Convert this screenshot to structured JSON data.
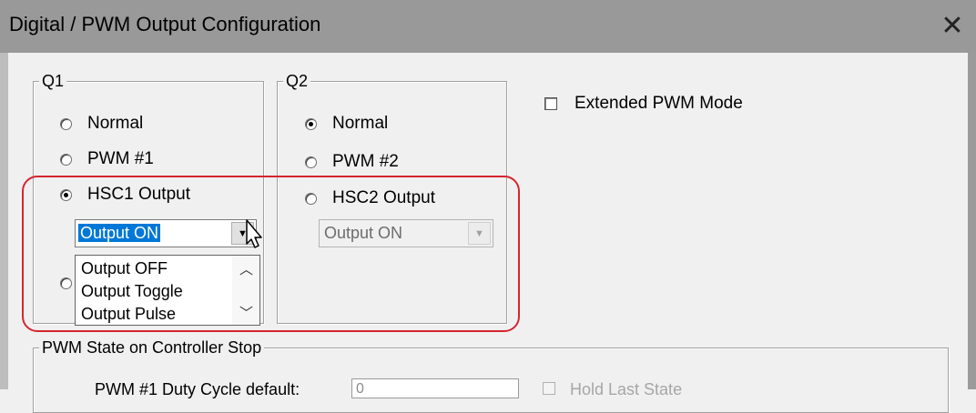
{
  "window": {
    "title": "Digital / PWM Output Configuration",
    "close_glyph": "✕"
  },
  "q1": {
    "legend": "Q1",
    "options": [
      {
        "label": "Normal",
        "checked": false
      },
      {
        "label": "PWM #1",
        "checked": false
      },
      {
        "label": "HSC1 Output",
        "checked": true
      }
    ],
    "combo_value": "Output ON"
  },
  "q2": {
    "legend": "Q2",
    "options": [
      {
        "label": "Normal",
        "checked": true
      },
      {
        "label": "PWM #2",
        "checked": false
      },
      {
        "label": "HSC2 Output",
        "checked": false
      }
    ],
    "combo_value": "Output ON"
  },
  "extended_pwm": {
    "label": "Extended PWM Mode",
    "checked": false
  },
  "dropdown": {
    "items": [
      "Output OFF",
      "Output Toggle",
      "Output Pulse"
    ]
  },
  "pwm_stop": {
    "legend": "PWM State on Controller Stop",
    "duty_label": "PWM #1 Duty Cycle default:",
    "duty_value": "0",
    "hold_label": "Hold Last State"
  },
  "colors": {
    "highlight": "#d6252f",
    "selection": "#0078d7",
    "titlebar": "#999999"
  },
  "icons": {
    "close": "close-icon",
    "combo_arrow": "chevron-down-icon",
    "cursor": "mouse-pointer-icon"
  }
}
